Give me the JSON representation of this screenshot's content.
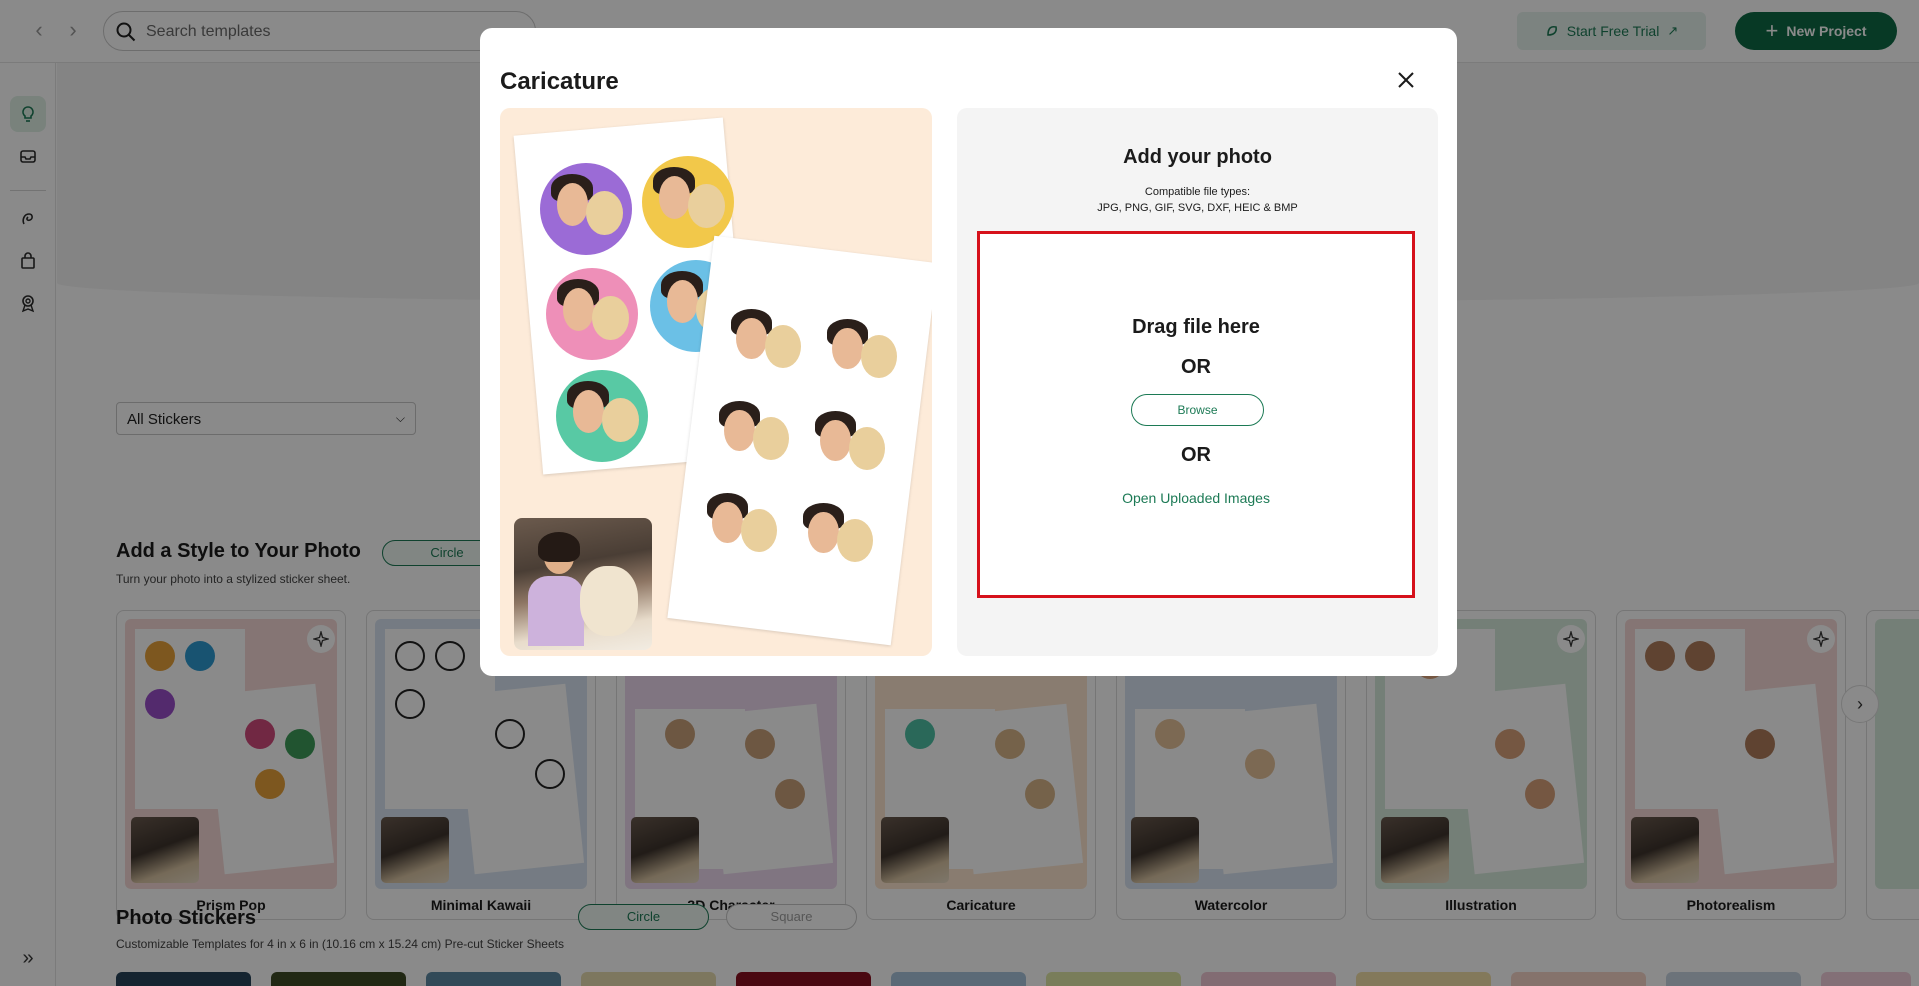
{
  "topbar": {
    "search_placeholder": "Search templates",
    "trial_label": "Start Free Trial",
    "new_project_label": "New Project"
  },
  "filters": {
    "sticker_select_value": "All Stickers"
  },
  "style_section": {
    "title": "Add a Style to Your Photo",
    "subtitle": "Turn your photo into a stylized sticker sheet.",
    "pill_circle": "Circle",
    "cards": [
      {
        "label": "Prism Pop",
        "color": "#f6d9d6"
      },
      {
        "label": "Minimal Kawaii",
        "color": "#d9e4f2"
      },
      {
        "label": "3D Character",
        "color": "#ecd9ef"
      },
      {
        "label": "Caricature",
        "color": "#fde6cf"
      },
      {
        "label": "Watercolor",
        "color": "#d9e4f2"
      },
      {
        "label": "Illustration",
        "color": "#d7ebdc"
      },
      {
        "label": "Photorealism",
        "color": "#f6d9d6"
      }
    ]
  },
  "photo_section": {
    "title": "Photo Stickers",
    "subtitle": "Customizable Templates for 4 in x 6 in (10.16 cm x 15.24 cm) Pre-cut Sticker Sheets",
    "pill_circle": "Circle",
    "pill_square": "Square"
  },
  "modal": {
    "title": "Caricature",
    "upload": {
      "title": "Add your photo",
      "types_line1": "Compatible file types:",
      "types_line2": "JPG, PNG, GIF, SVG, DXF, HEIC & BMP",
      "drag_text": "Drag file here",
      "or_1": "OR",
      "browse_label": "Browse",
      "or_2": "OR",
      "open_uploaded_label": "Open Uploaded Images"
    }
  },
  "colors": {
    "brand_green": "#0e6a45",
    "accent_green": "#1c7a55",
    "highlight_red": "#d6111b"
  }
}
